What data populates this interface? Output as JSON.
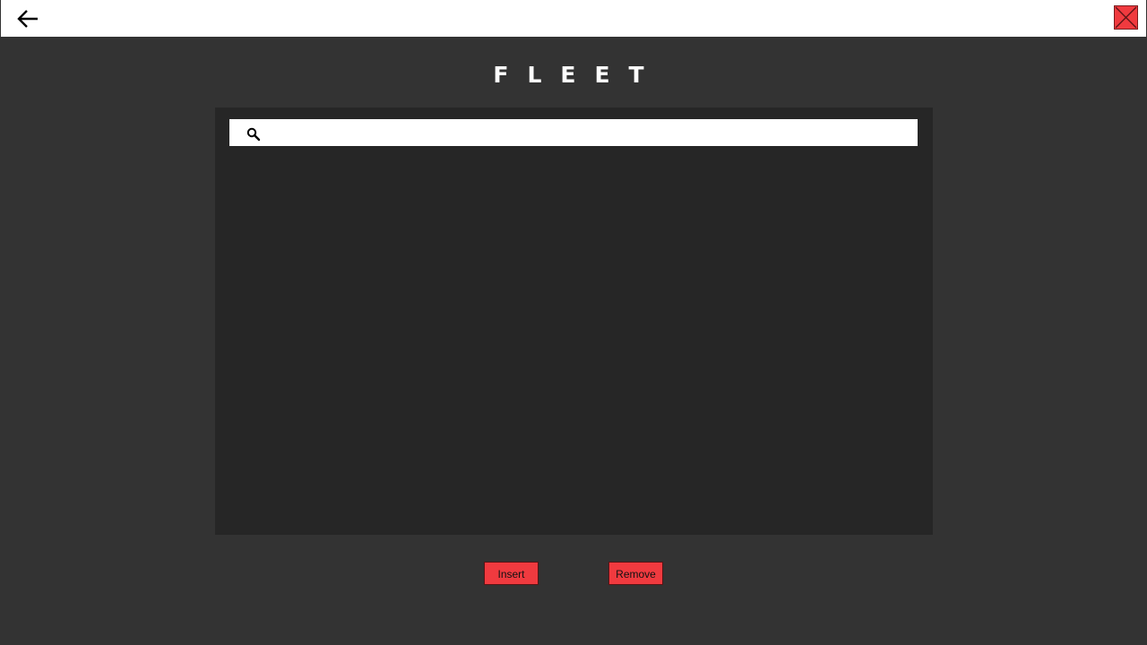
{
  "titlebar": {
    "back_icon": "arrow-left-icon",
    "close_icon": "close-icon",
    "close_color": "#f03a3f"
  },
  "page": {
    "title": "FLEET"
  },
  "search": {
    "icon": "search-icon",
    "value": "",
    "placeholder": ""
  },
  "fleet_list": {
    "items": []
  },
  "actions": {
    "insert_label": "Insert",
    "remove_label": "Remove",
    "button_color": "#f03a3f"
  },
  "colors": {
    "background": "#333333",
    "panel": "#262626",
    "titlebar": "#ffffff",
    "accent": "#f03a3f"
  }
}
